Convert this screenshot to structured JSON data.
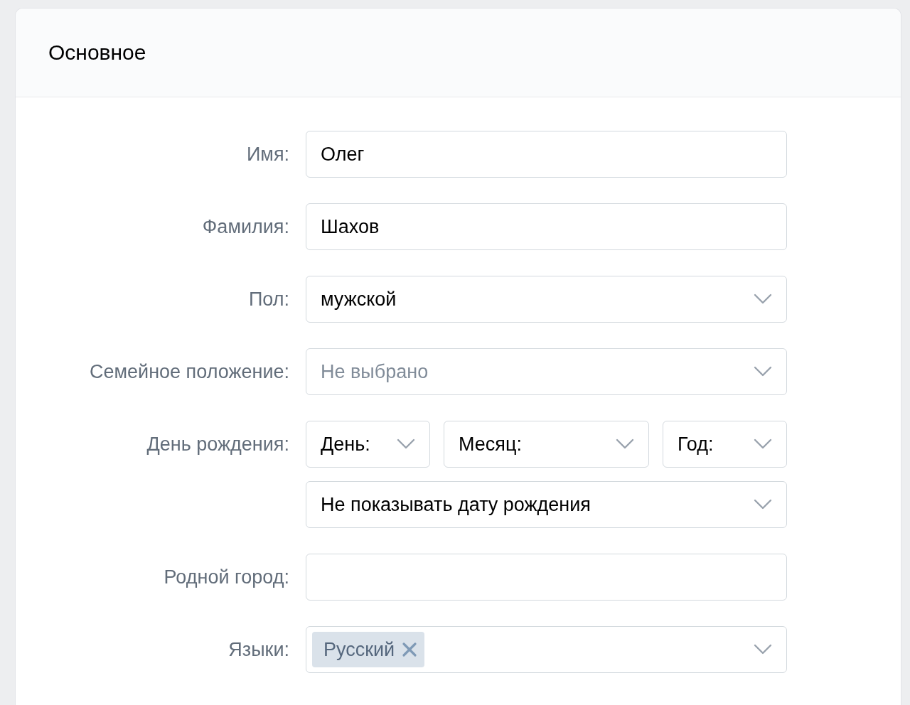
{
  "section": {
    "title": "Основное"
  },
  "fields": [
    {
      "kind": "text",
      "label": "Имя:",
      "value": "Олег"
    },
    {
      "kind": "text",
      "label": "Фамилия:",
      "value": "Шахов"
    },
    {
      "kind": "select",
      "label": "Пол:",
      "value": "мужской"
    },
    {
      "kind": "select",
      "label": "Семейное положение:",
      "placeholder": "Не выбрано"
    },
    {
      "kind": "date",
      "label": "День рождения:",
      "parts": [
        {
          "placeholder": "День:"
        },
        {
          "placeholder": "Месяц:"
        },
        {
          "placeholder": "Год:"
        }
      ],
      "visibility": "Не показывать дату рождения"
    },
    {
      "kind": "text",
      "label": "Родной город:"
    },
    {
      "kind": "tags",
      "label": "Языки:",
      "tags": [
        "Русский"
      ]
    }
  ]
}
